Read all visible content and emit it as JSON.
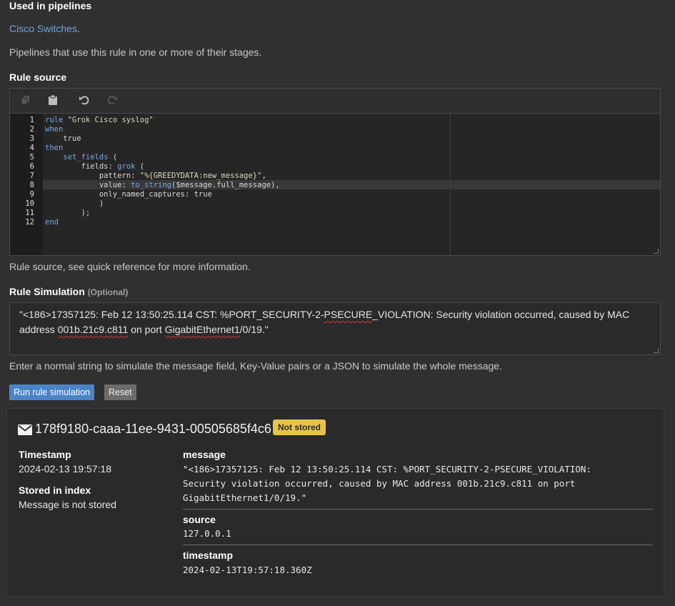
{
  "pipelines": {
    "heading": "Used in pipelines",
    "link": "Cisco Switches",
    "link_suffix": ".",
    "description": "Pipelines that use this rule in one or more of their stages."
  },
  "rule_source": {
    "heading": "Rule source",
    "toolbar": [
      "copy-icon",
      "paste-icon",
      "undo-icon",
      "redo-icon"
    ],
    "line_numbers": [
      "1",
      "2",
      "3",
      "4",
      "5",
      "6",
      "7",
      "8",
      "9",
      "10",
      "11",
      "12"
    ],
    "help": "Rule source, see quick reference for more information."
  },
  "code": {
    "l1a": "rule ",
    "l1b": "\"Grok Cisco syslog\"",
    "l2": "when",
    "l3": "    true",
    "l4": "then",
    "l5a": "    ",
    "l5b": "set_fields",
    "l5c": " (",
    "l6a": "        fields: ",
    "l6b": "grok",
    "l6c": " (",
    "l7a": "            pattern: ",
    "l7b": "\"%{GREEDYDATA:new_message}\"",
    "l7c": ",",
    "l8a": "            value: ",
    "l8b": "to_string",
    "l8c": "($message.full_message),",
    "l9": "            only_named_captures: true",
    "l10": "            )",
    "l11": "        );",
    "l12": "end"
  },
  "simulation": {
    "heading": "Rule Simulation",
    "optional": "(Optional)",
    "text_a": "\"<186>17357125: Feb 12 13:50:25.114 CST: %PORT_SECURITY-2-",
    "text_b": "PSECURE",
    "text_c": "_VIOLATION: Security violation occurred, caused by MAC address ",
    "text_d": "001b.21c9.c811",
    "text_e": " on port ",
    "text_f": "GigabitEthernet1",
    "text_g": "/0/19.\"",
    "help": "Enter a normal string to simulate the message field, Key-Value pairs or a JSON to simulate the whole message.",
    "run_button": "Run rule simulation",
    "reset_button": "Reset"
  },
  "result": {
    "message_id": "178f9180-caaa-11ee-9431-00505685f4c6",
    "badge": "Not stored",
    "timestamp_label": "Timestamp",
    "timestamp_value": "2024-02-13 19:57:18",
    "stored_label": "Stored in index",
    "stored_value": "Message is not stored",
    "fields": {
      "message_label": "message",
      "message_line1": "\"<186>17357125: Feb 12 13:50:25.114 CST: %PORT_SECURITY-2-PSECURE_VIOLATION:",
      "message_line2": "Security violation occurred, caused by MAC address 001b.21c9.c811 on port",
      "message_line3": "GigabitEthernet1/0/19.\"",
      "source_label": "source",
      "source_value": "127.0.0.1",
      "timestamp_label": "timestamp",
      "timestamp_value": "2024-02-13T19:57:18.360Z"
    }
  },
  "colors": {
    "background": "#303030",
    "link": "#6ea4e0",
    "primary_button": "#4a84c6",
    "badge": "#e8c34a"
  }
}
